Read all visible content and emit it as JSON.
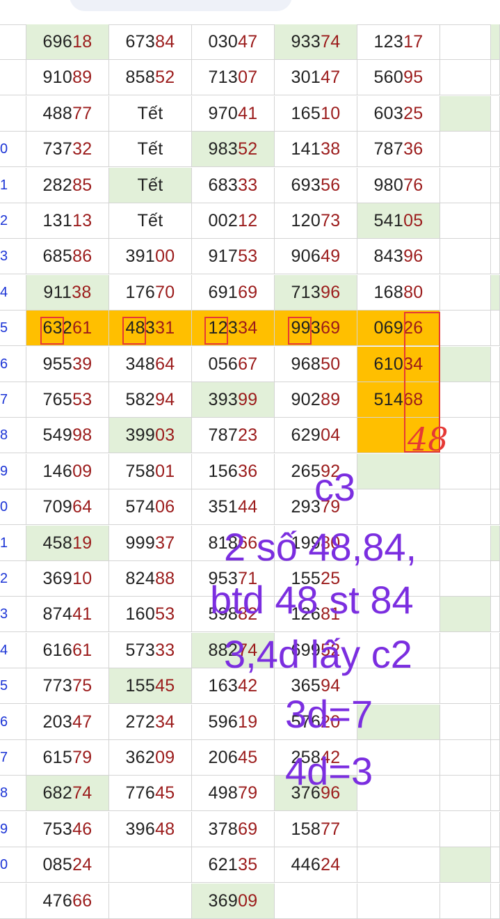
{
  "row_indices": [
    "",
    "",
    "",
    "0",
    "1",
    "2",
    "3",
    "4",
    "5",
    "6",
    "7",
    "8",
    "9",
    "0",
    "1",
    "2",
    "3",
    "4",
    "5",
    "6",
    "7",
    "8",
    "9",
    "0",
    ""
  ],
  "rows": [
    {
      "c": [
        [
          "696",
          "18"
        ],
        [
          "673",
          "84"
        ],
        [
          "030",
          "47"
        ],
        [
          "933",
          "74"
        ],
        [
          "123",
          "17"
        ]
      ],
      "g": [
        0,
        3
      ],
      "e": [
        6
      ]
    },
    {
      "c": [
        [
          "910",
          "89"
        ],
        [
          "858",
          "52"
        ],
        [
          "713",
          "07"
        ],
        [
          "301",
          "47"
        ],
        [
          "560",
          "95"
        ]
      ],
      "g": [],
      "e": []
    },
    {
      "c": [
        [
          "488",
          "77"
        ],
        [
          "Tết",
          ""
        ],
        [
          "970",
          "41"
        ],
        [
          "165",
          "10"
        ],
        [
          "603",
          "25"
        ]
      ],
      "g": [],
      "e": [
        5
      ]
    },
    {
      "c": [
        [
          "737",
          "32"
        ],
        [
          "Tết",
          ""
        ],
        [
          "983",
          "52"
        ],
        [
          "141",
          "38"
        ],
        [
          "787",
          "36"
        ]
      ],
      "g": [
        2
      ],
      "e": []
    },
    {
      "c": [
        [
          "282",
          "85"
        ],
        [
          "Tết",
          ""
        ],
        [
          "683",
          "33"
        ],
        [
          "693",
          "56"
        ],
        [
          "980",
          "76"
        ]
      ],
      "g": [
        1
      ],
      "e": []
    },
    {
      "c": [
        [
          "131",
          "13"
        ],
        [
          "Tết",
          ""
        ],
        [
          "002",
          "12"
        ],
        [
          "120",
          "73"
        ],
        [
          "541",
          "05"
        ]
      ],
      "g": [
        4
      ],
      "e": []
    },
    {
      "c": [
        [
          "685",
          "86"
        ],
        [
          "391",
          "00"
        ],
        [
          "917",
          "53"
        ],
        [
          "906",
          "49"
        ],
        [
          "843",
          "96"
        ]
      ],
      "g": [],
      "e": []
    },
    {
      "c": [
        [
          "911",
          "38"
        ],
        [
          "176",
          "70"
        ],
        [
          "691",
          "69"
        ],
        [
          "713",
          "96"
        ],
        [
          "168",
          "80"
        ]
      ],
      "g": [
        0,
        3
      ],
      "e": [
        6
      ]
    },
    {
      "c": [
        [
          "632",
          "61"
        ],
        [
          "483",
          "31"
        ],
        [
          "123",
          "34"
        ],
        [
          "993",
          "69"
        ],
        [
          "069",
          "26"
        ]
      ],
      "g": [],
      "o": [
        0,
        1,
        2,
        3,
        4
      ],
      "e": []
    },
    {
      "c": [
        [
          "955",
          "39"
        ],
        [
          "348",
          "64"
        ],
        [
          "056",
          "67"
        ],
        [
          "968",
          "50"
        ],
        [
          "610",
          "34"
        ]
      ],
      "g": [],
      "o": [
        4
      ],
      "e": [
        5
      ]
    },
    {
      "c": [
        [
          "765",
          "53"
        ],
        [
          "582",
          "94"
        ],
        [
          "393",
          "99"
        ],
        [
          "902",
          "89"
        ],
        [
          "514",
          "68"
        ]
      ],
      "g": [
        2
      ],
      "o": [
        4
      ],
      "e": []
    },
    {
      "c": [
        [
          "549",
          "98"
        ],
        [
          "399",
          "03"
        ],
        [
          "787",
          "23"
        ],
        [
          "629",
          "04"
        ],
        [
          "",
          ""
        ]
      ],
      "g": [
        1
      ],
      "o": [
        4
      ],
      "e": []
    },
    {
      "c": [
        [
          "146",
          "09"
        ],
        [
          "758",
          "01"
        ],
        [
          "156",
          "36"
        ],
        [
          "265",
          "92"
        ],
        [
          "",
          ""
        ]
      ],
      "g": [
        4
      ],
      "e": []
    },
    {
      "c": [
        [
          "709",
          "64"
        ],
        [
          "574",
          "06"
        ],
        [
          "351",
          "44"
        ],
        [
          "293",
          "79"
        ],
        [
          "",
          ""
        ]
      ],
      "g": [],
      "e": []
    },
    {
      "c": [
        [
          "458",
          "19"
        ],
        [
          "999",
          "37"
        ],
        [
          "818",
          "66"
        ],
        [
          "199",
          "80"
        ],
        [
          "",
          ""
        ]
      ],
      "g": [
        0
      ],
      "e": [
        6
      ]
    },
    {
      "c": [
        [
          "369",
          "10"
        ],
        [
          "824",
          "88"
        ],
        [
          "953",
          "71"
        ],
        [
          "155",
          "25"
        ],
        [
          "",
          ""
        ]
      ],
      "g": [],
      "e": []
    },
    {
      "c": [
        [
          "874",
          "41"
        ],
        [
          "160",
          "53"
        ],
        [
          "598",
          "82"
        ],
        [
          "126",
          "81"
        ],
        [
          "",
          ""
        ]
      ],
      "g": [],
      "e": [
        5
      ]
    },
    {
      "c": [
        [
          "616",
          "61"
        ],
        [
          "573",
          "33"
        ],
        [
          "882",
          "74"
        ],
        [
          "699",
          "52"
        ],
        [
          "",
          ""
        ]
      ],
      "g": [
        2
      ],
      "e": []
    },
    {
      "c": [
        [
          "773",
          "75"
        ],
        [
          "155",
          "45"
        ],
        [
          "163",
          "42"
        ],
        [
          "365",
          "94"
        ],
        [
          "",
          ""
        ]
      ],
      "g": [
        1
      ],
      "e": []
    },
    {
      "c": [
        [
          "203",
          "47"
        ],
        [
          "272",
          "34"
        ],
        [
          "596",
          "19"
        ],
        [
          "576",
          "20"
        ],
        [
          "",
          ""
        ]
      ],
      "g": [
        4
      ],
      "e": []
    },
    {
      "c": [
        [
          "615",
          "79"
        ],
        [
          "362",
          "09"
        ],
        [
          "206",
          "45"
        ],
        [
          "258",
          "42"
        ],
        [
          "",
          ""
        ]
      ],
      "g": [],
      "e": []
    },
    {
      "c": [
        [
          "682",
          "74"
        ],
        [
          "776",
          "45"
        ],
        [
          "498",
          "79"
        ],
        [
          "376",
          "96"
        ],
        [
          "",
          ""
        ]
      ],
      "g": [
        0,
        3
      ],
      "e": []
    },
    {
      "c": [
        [
          "753",
          "46"
        ],
        [
          "396",
          "48"
        ],
        [
          "378",
          "69"
        ],
        [
          "158",
          "77"
        ],
        [
          "",
          ""
        ]
      ],
      "g": [],
      "e": []
    },
    {
      "c": [
        [
          "085",
          "24"
        ],
        [
          "",
          ""
        ],
        [
          "621",
          "35"
        ],
        [
          "446",
          "24"
        ],
        [
          "",
          ""
        ]
      ],
      "g": [],
      "e": [
        5
      ]
    },
    {
      "c": [
        [
          "476",
          "66"
        ],
        [
          "",
          ""
        ],
        [
          "369",
          "09"
        ],
        [
          "",
          ""
        ],
        [
          "",
          ""
        ]
      ],
      "g": [
        2
      ],
      "e": []
    }
  ],
  "handwriting": {
    "red_number": "48",
    "lines": [
      "c3",
      "2 số 48,84,",
      "btd 48 st 84",
      "3,4d lấy c2",
      "3d=7",
      "4d=3"
    ]
  }
}
